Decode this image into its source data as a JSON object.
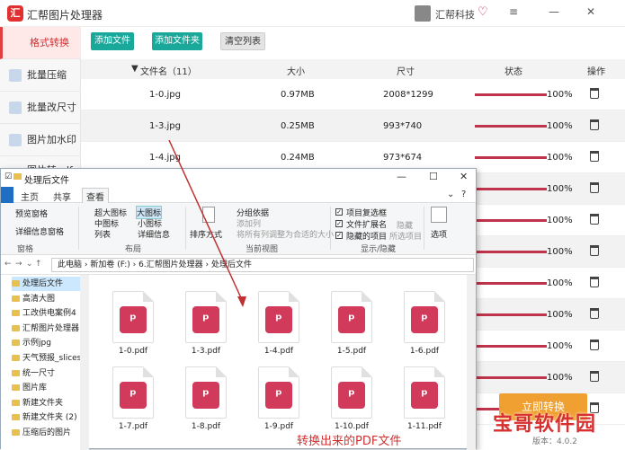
{
  "app": {
    "title": "汇帮图片处理器",
    "user": "汇帮科技",
    "logo": "汇",
    "version": "版本：4.0.2"
  },
  "sidebar": [
    "格式转换",
    "批量压缩",
    "批量改尺寸",
    "图片加水印",
    "图片转pdf"
  ],
  "toolbar": {
    "add_file": "添加文件",
    "add_folder": "添加文件夹",
    "clear": "清空列表"
  },
  "table": {
    "headers": [
      "文件名（11）",
      "大小",
      "尺寸",
      "状态",
      "操作"
    ],
    "rows": [
      {
        "name": "1-0.jpg",
        "size": "0.97MB",
        "dim": "2008*1299",
        "status": "100%"
      },
      {
        "name": "1-3.jpg",
        "size": "0.25MB",
        "dim": "993*740",
        "status": "100%"
      },
      {
        "name": "1-4.jpg",
        "size": "0.24MB",
        "dim": "973*674",
        "status": "100%"
      },
      {
        "status": "100%"
      },
      {
        "status": "100%"
      },
      {
        "status": "100%"
      },
      {
        "status": "100%"
      },
      {
        "status": "100%"
      },
      {
        "status": "100%"
      },
      {
        "status": "100%"
      },
      {
        "status": "100%"
      }
    ]
  },
  "convert": "立即转换",
  "explorer": {
    "title": "处理后文件",
    "tabs": [
      "主页",
      "共享",
      "查看"
    ],
    "ribbon": {
      "preview": "预览窗格",
      "details": "详细信息窗格",
      "pane_grp": "窗格",
      "xl": "超大图标",
      "large": "大图标",
      "medium": "中图标",
      "small": "小图标",
      "list": "列表",
      "detail": "详细信息",
      "layout_grp": "布局",
      "sort": "排序方式",
      "group": "分组依据",
      "addcol": "添加列",
      "fitcol": "将所有列调整为合适的大小",
      "view_grp": "当前视图",
      "chk1": "项目复选框",
      "chk2": "文件扩展名",
      "chk3": "隐藏的项目",
      "hide": "隐藏",
      "hide2": "所选项目",
      "show_grp": "显示/隐藏",
      "options": "选项"
    },
    "path": [
      "此电脑",
      "新加卷 (F:)",
      "6.汇帮图片处理器",
      "处理后文件"
    ],
    "tree": [
      "处理后文件",
      "高清大图",
      "工改供电案例4",
      "汇帮图片处理器",
      "示例jpg",
      "天气预报_slicesp",
      "统一尺寸",
      "图片库",
      "新建文件夹",
      "新建文件夹 (2)",
      "压缩后的图片"
    ],
    "files": [
      "1-0.pdf",
      "1-3.pdf",
      "1-4.pdf",
      "1-5.pdf",
      "1-6.pdf",
      "1-7.pdf",
      "1-8.pdf",
      "1-9.pdf",
      "1-10.pdf",
      "1-11.pdf"
    ]
  },
  "annotation": "转换出来的PDF文件",
  "watermark": "宝哥软件园",
  "colors": {
    "accent": "#1aa89a",
    "progress": "#c0334d",
    "pdf": "#d23a5c",
    "convert": "#f0a030"
  }
}
